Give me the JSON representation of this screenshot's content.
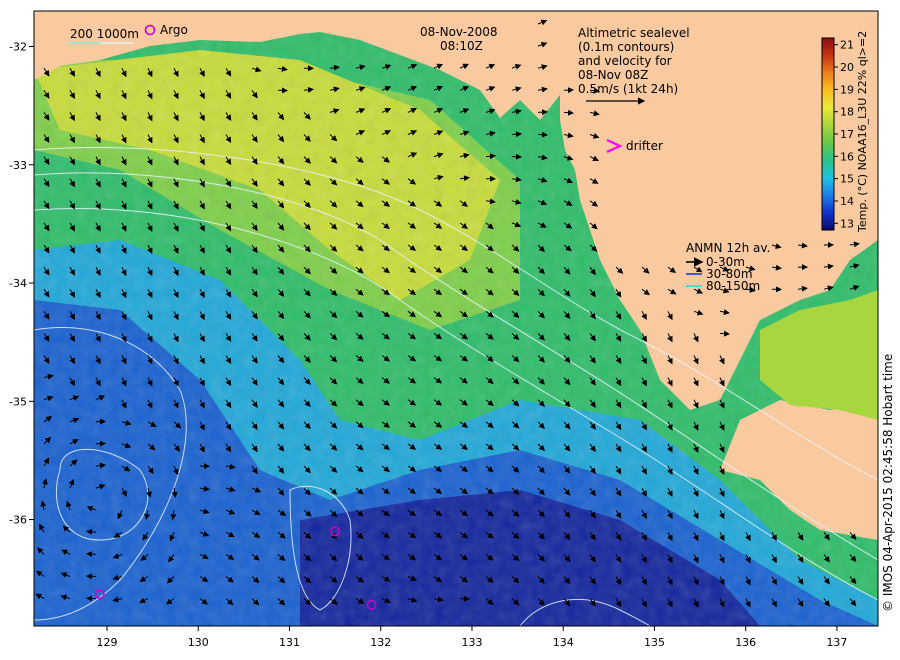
{
  "header": {
    "date": "08-Nov-2008",
    "time": "08:10Z"
  },
  "altimetry_note": [
    "Altimetric sealevel",
    "(0.1m contours)",
    "and velocity for",
    "08-Nov 08Z",
    "0.5m/s (1kt 24h)"
  ],
  "depth_legend": {
    "label": "200  1000m"
  },
  "argo_legend": {
    "label": "Argo",
    "color": "#cc00cc"
  },
  "drifter_legend": {
    "label": "drifter",
    "color": "#ff00ff"
  },
  "anmn_legend": {
    "title": "ANMN 12h av.",
    "items": [
      {
        "label": "0-30m",
        "color": "#000000"
      },
      {
        "label": "30-80m",
        "color": "#1a3fd0"
      },
      {
        "label": "80-150m",
        "color": "#22e0e0"
      }
    ]
  },
  "colorbar": {
    "title": "Temp. (°C) NOAA16_L3U 22% ql>=2",
    "ticks": [
      "13",
      "14",
      "15",
      "16",
      "17",
      "18",
      "19",
      "20",
      "21"
    ],
    "min": 12.7,
    "max": 21.3,
    "colors": [
      "#0b0b6a",
      "#1133cc",
      "#1e7fe8",
      "#1fc1e0",
      "#2fc28a",
      "#66c84a",
      "#aad63c",
      "#eae83a",
      "#f7c020",
      "#ee7e1a",
      "#c63214",
      "#8a0f0f"
    ]
  },
  "axes": {
    "x_ticks": [
      "129",
      "130",
      "131",
      "132",
      "133",
      "134",
      "135",
      "136",
      "137"
    ],
    "x_values": [
      129,
      130,
      131,
      132,
      133,
      134,
      135,
      136,
      137
    ],
    "y_ticks": [
      "-32",
      "-33",
      "-34",
      "-35",
      "-36"
    ],
    "y_values": [
      -32,
      -33,
      -34,
      -35,
      -36
    ],
    "lon_range": [
      128.2,
      137.45
    ],
    "lat_range": [
      -36.9,
      -31.7
    ]
  },
  "land_color": "#f9c9a0",
  "credit": "© IMOS 04-Apr-2015 02:45:58 Hobart time",
  "argo_floats": [
    {
      "lon": 129.55,
      "lat": -31.55
    },
    {
      "lon": 128.92,
      "lat": -36.63
    },
    {
      "lon": 131.5,
      "lat": -36.1
    },
    {
      "lon": 131.9,
      "lat": -36.72
    }
  ]
}
